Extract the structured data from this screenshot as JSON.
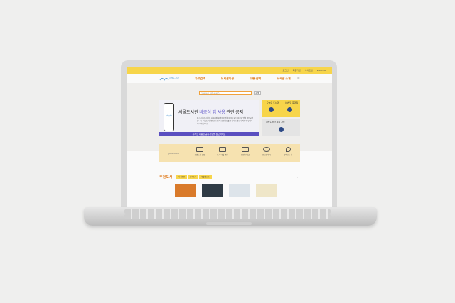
{
  "top_links": [
    "로그인",
    "회원가입",
    "사이트맵",
    "ENGLISH"
  ],
  "logo_text": "서울도서관",
  "nav": [
    "자료검색",
    "도서관이용",
    "소통·참여",
    "도서관 소개"
  ],
  "search": {
    "placeholder": "검색어를 입력하세요",
    "button": "검색"
  },
  "notice": {
    "title_prefix": "서울도서관 ",
    "title_highlight": "비공식 앱 사용",
    "title_suffix": " 관련 공지",
    "body": "최근 서울도서관을 사칭하여 회원정보 입력을 유도하는 비공식 앱이 확인되었습니다. 서울도서관은 공식 앱 외 회원정보를 수집하지 않으니 이용에 유의하시기 바랍니다.",
    "bar": "자세한 내용은 공지사항을 참고하세요"
  },
  "side": {
    "box1_label_1": "오늘의 도서관",
    "box1_label_2": "이번 달 휴관일",
    "box2_label": "서울도서관 회원 가입"
  },
  "quick_menu": {
    "title": "Quick Menu",
    "items": [
      "희망도서 신청",
      "도서 대출 연장",
      "회원증 발급",
      "묻고답하기",
      "찾아오는 길"
    ]
  },
  "recommend": {
    "title": "추천도서",
    "tabs": [
      "사서추천",
      "신착도서",
      "대출베스트"
    ]
  },
  "colors": {
    "accent": "#f7d54a",
    "brand": "#e07a1a",
    "notice": "#5a4fc0"
  }
}
